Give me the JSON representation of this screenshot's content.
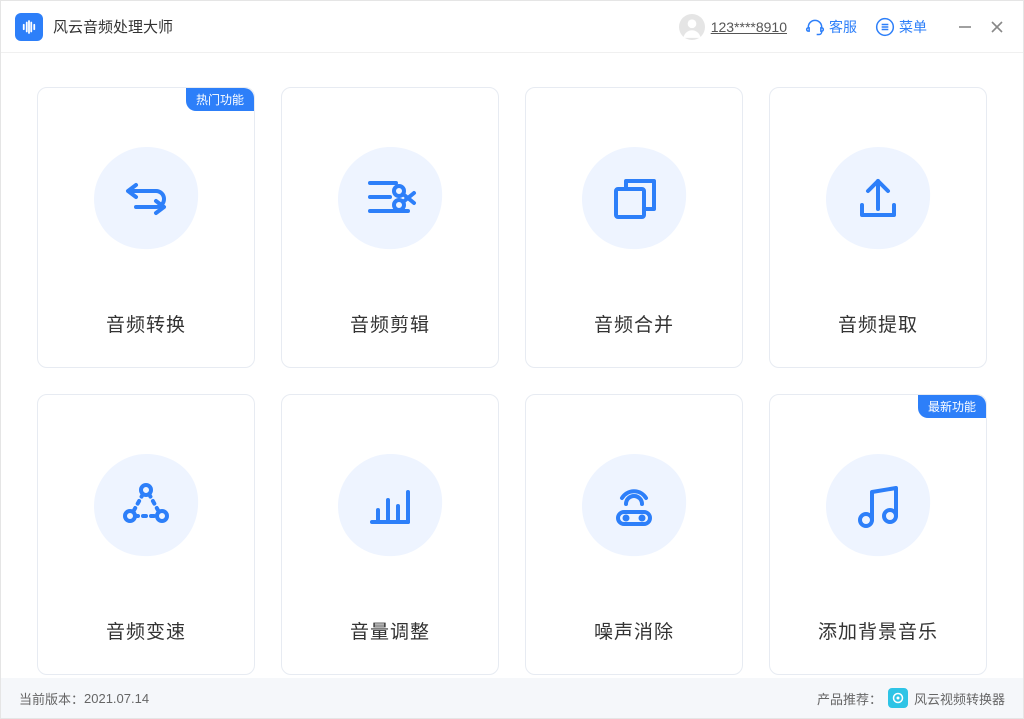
{
  "header": {
    "app_title": "风云音频处理大师",
    "user_id": "123****8910",
    "support_label": "客服",
    "menu_label": "菜单"
  },
  "badges": {
    "hot": "热门功能",
    "new": "最新功能"
  },
  "cards": [
    {
      "label": "音频转换"
    },
    {
      "label": "音频剪辑"
    },
    {
      "label": "音频合并"
    },
    {
      "label": "音频提取"
    },
    {
      "label": "音频变速"
    },
    {
      "label": "音量调整"
    },
    {
      "label": "噪声消除"
    },
    {
      "label": "添加背景音乐"
    }
  ],
  "footer": {
    "version_prefix": "当前版本：",
    "version": "2021.07.14",
    "recommend_prefix": "产品推荐：",
    "recommend_name": "风云视频转换器"
  }
}
